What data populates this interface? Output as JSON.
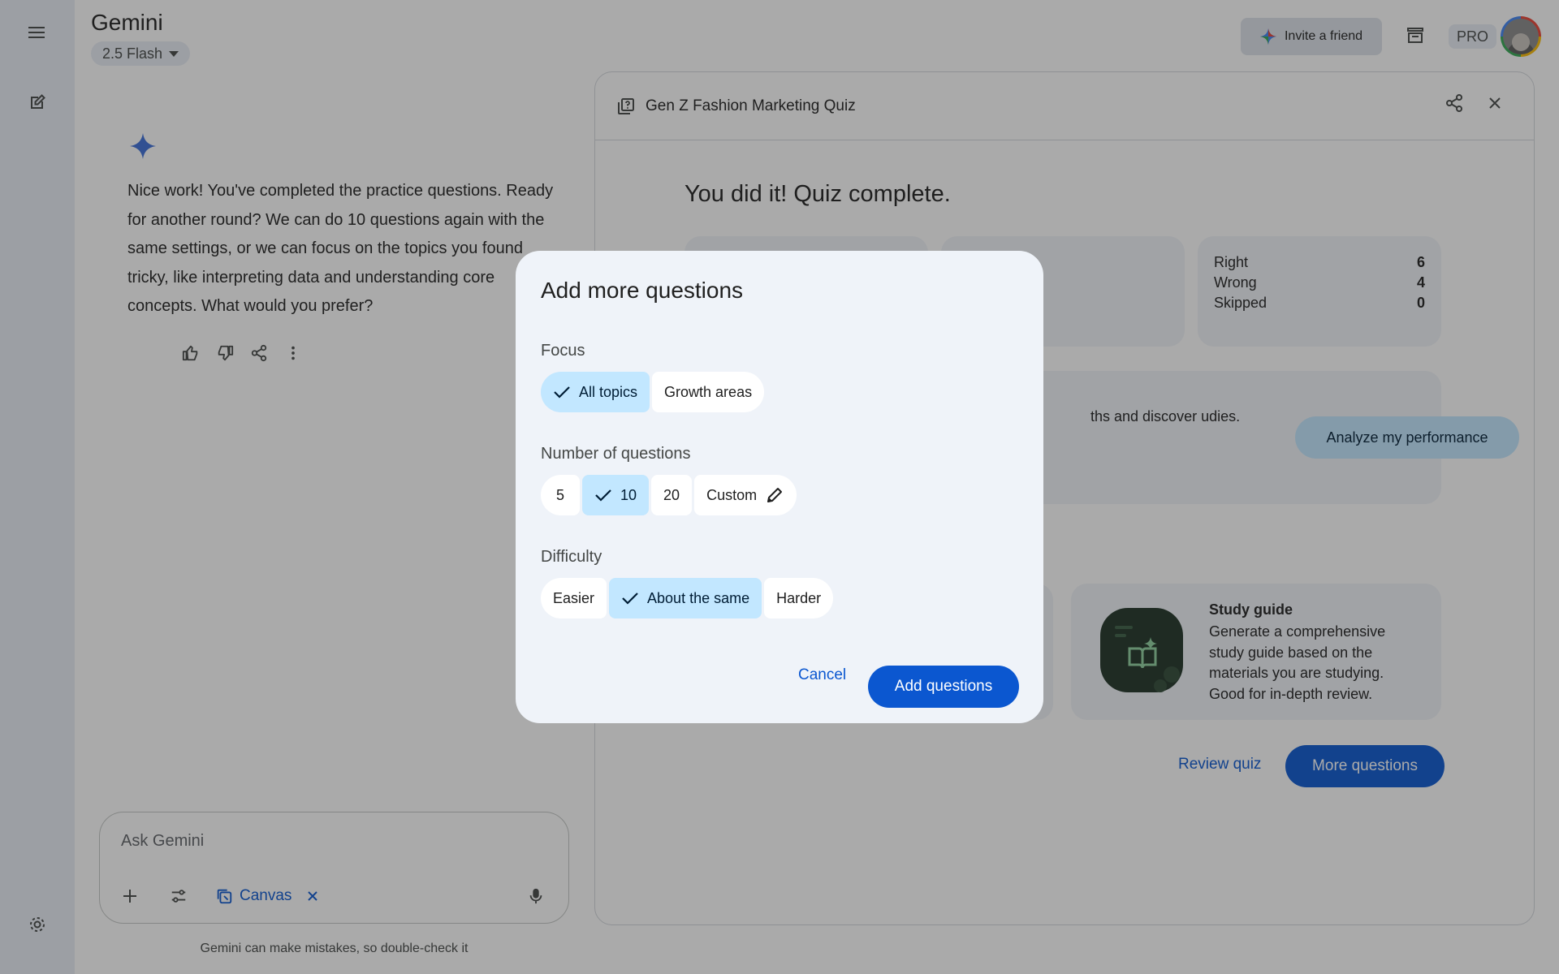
{
  "app": {
    "title": "Gemini",
    "model": "2.5 Flash"
  },
  "header": {
    "invite_label": "Invite a friend",
    "pro_label": "PRO"
  },
  "chat": {
    "response": "Nice work! You've completed the practice questions. Ready for another round? We can do 10 questions again with the same settings, or we can focus on the topics you found tricky, like interpreting data and understanding core concepts. What would you prefer?"
  },
  "input": {
    "placeholder": "Ask Gemini",
    "canvas_chip": "Canvas"
  },
  "disclaimer": "Gemini can make mistakes, so double-check it",
  "canvas": {
    "title": "Gen Z Fashion Marketing Quiz",
    "complete_heading": "You did it! Quiz complete.",
    "stats": {
      "right_label": "Right",
      "right": "6",
      "wrong_label": "Wrong",
      "wrong": "4",
      "skipped_label": "Skipped",
      "skipped": "0"
    },
    "analyze_text": "ths and discover udies.",
    "analyze_button": "Analyze my performance",
    "study_guide": {
      "title": "Study guide",
      "description": "Generate a comprehensive study guide based on the materials you are studying. Good for in-depth review."
    },
    "review_label": "Review quiz",
    "more_label": "More questions"
  },
  "dialog": {
    "title": "Add more questions",
    "focus_label": "Focus",
    "focus_options": [
      "All topics",
      "Growth areas"
    ],
    "focus_selected": "All topics",
    "count_label": "Number of questions",
    "count_options": [
      "5",
      "10",
      "20",
      "Custom"
    ],
    "count_selected": "10",
    "difficulty_label": "Difficulty",
    "difficulty_options": [
      "Easier",
      "About the same",
      "Harder"
    ],
    "difficulty_selected": "About the same",
    "cancel_label": "Cancel",
    "add_label": "Add questions"
  },
  "colors": {
    "accent": "#0b57d0",
    "selected_chip": "#c2e7ff",
    "dialog_bg": "#eff3f9"
  }
}
